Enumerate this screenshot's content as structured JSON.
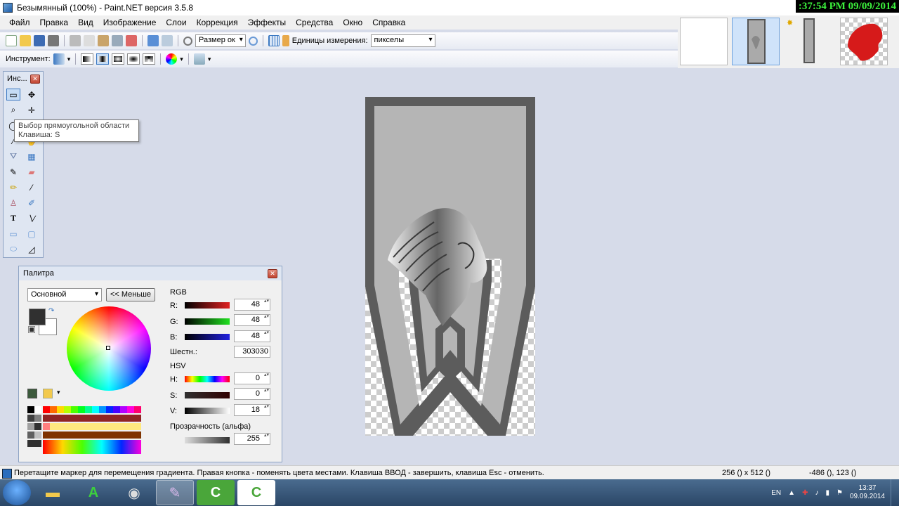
{
  "window": {
    "title": "Безымянный (100%) - Paint.NET версия 3.5.8",
    "overlay_clock": ":37:54 PM 09/09/2014"
  },
  "menu": [
    "Файл",
    "Правка",
    "Вид",
    "Изображение",
    "Слои",
    "Коррекция",
    "Эффекты",
    "Средства",
    "Окно",
    "Справка"
  ],
  "toolbar": {
    "zoom_combo": "Размер ок",
    "units_label": "Единицы измерения:",
    "units_value": "пикселы",
    "tool_label": "Инструмент:"
  },
  "tools_window": {
    "title": "Инс...",
    "tooltip_line1": "Выбор прямоугольной области",
    "tooltip_line2": "Клавиша: S"
  },
  "palette": {
    "title": "Палитра",
    "mode": "Основной",
    "less_button": "<< Меньше",
    "rgb_label": "RGB",
    "r_label": "R:",
    "r_value": "48",
    "g_label": "G:",
    "g_value": "48",
    "b_label": "B:",
    "b_value": "48",
    "hex_label": "Шестн.:",
    "hex_value": "303030",
    "hsv_label": "HSV",
    "h_label": "H:",
    "h_value": "0",
    "s_label": "S:",
    "s_value": "0",
    "v_label": "V:",
    "v_value": "18",
    "alpha_label": "Прозрачность (альфа)",
    "alpha_value": "255",
    "primary_color": "#303030",
    "secondary_color": "#ffffff"
  },
  "status": {
    "message": "Перетащите маркер для перемещения градиента. Правая кнопка - поменять цвета местами. Клавиша ВВОД - завершить, клавиша Esc - отменить.",
    "dimensions": "256 () x 512 ()",
    "position": "-486 (), 123 ()"
  },
  "taskbar": {
    "lang": "EN",
    "time": "13:37",
    "date": "09.09.2014"
  }
}
